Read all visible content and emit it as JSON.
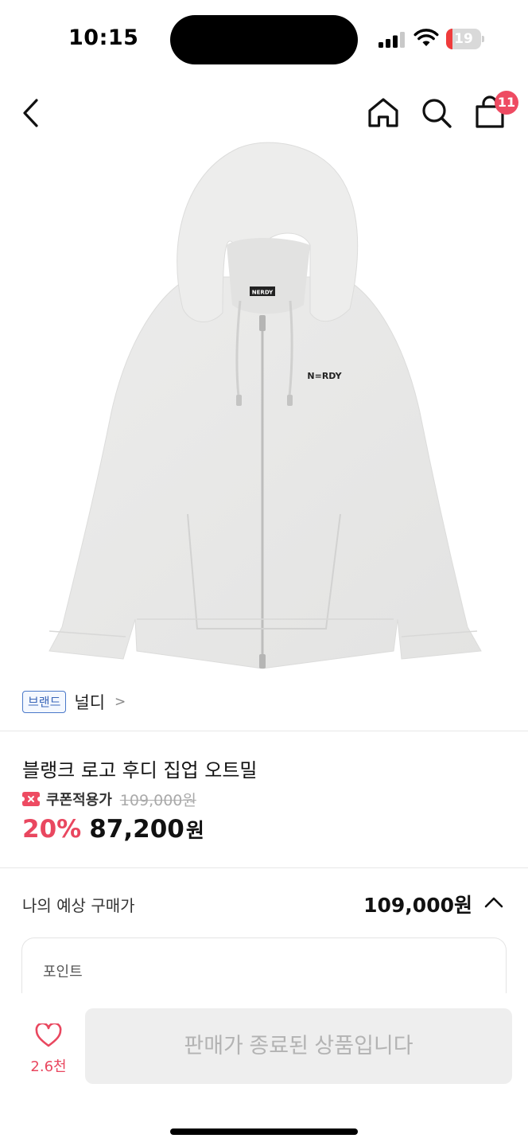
{
  "status": {
    "time": "10:15",
    "battery": "19",
    "battery_level": 0.19
  },
  "header": {
    "cart_count": "11"
  },
  "product": {
    "logo_text": "N=RDY",
    "tag_text": "NERDY"
  },
  "brand": {
    "tag": "브랜드",
    "name": "널디",
    "chevron": ">"
  },
  "details": {
    "title": "블랭크 로고 후디 집업 오트밀",
    "coupon_label": "쿠폰적용가",
    "original_price": "109,000원",
    "discount": "20%",
    "price": "87,200",
    "currency": "원"
  },
  "expected": {
    "label": "나의 예상 구매가",
    "value": "109,000원"
  },
  "point": {
    "label": "포인트"
  },
  "bottom": {
    "like_count": "2.6천",
    "button_label": "판매가 종료된 상품입니다"
  },
  "colors": {
    "accent": "#e9475f",
    "brand_tag": "#3a66b8",
    "badge": "#ee4b62"
  }
}
